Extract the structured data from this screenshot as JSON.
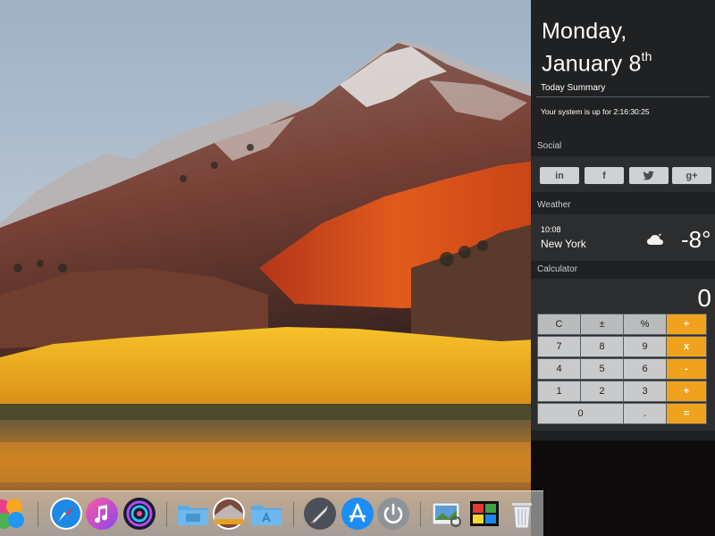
{
  "notification_center": {
    "date_line1": "Monday,",
    "date_day": "January 8",
    "date_suffix": "th",
    "today_summary_title": "Today Summary",
    "uptime_text": "Your system is up for 2:16:30:25",
    "social": {
      "label": "Social",
      "buttons": [
        {
          "name": "linkedin",
          "glyph": "in"
        },
        {
          "name": "facebook",
          "glyph": "f"
        },
        {
          "name": "twitter",
          "glyph": "🐦"
        },
        {
          "name": "googleplus",
          "glyph": "g+"
        }
      ]
    },
    "weather": {
      "label": "Weather",
      "time": "10:08",
      "city": "New York",
      "temperature": "-8°",
      "icon": "cloudy-night-icon"
    },
    "calculator": {
      "label": "Calculator",
      "display": "0",
      "keys": {
        "clear": "C",
        "plus_minus": "±",
        "percent": "%",
        "divide": "÷",
        "seven": "7",
        "eight": "8",
        "nine": "9",
        "multiply": "x",
        "four": "4",
        "five": "5",
        "six": "6",
        "minus": "-",
        "one": "1",
        "two": "2",
        "three": "3",
        "plus": "+",
        "zero": "0",
        "decimal": ".",
        "equals": "="
      }
    }
  },
  "dock": {
    "items": [
      {
        "name": "game-center-icon"
      },
      {
        "name": "safari-icon"
      },
      {
        "name": "itunes-icon"
      },
      {
        "name": "siri-icon"
      },
      {
        "name": "desktop-folder-icon"
      },
      {
        "name": "wallpaper-icon"
      },
      {
        "name": "applications-folder-icon"
      },
      {
        "name": "launchpad-icon"
      },
      {
        "name": "app-store-icon"
      },
      {
        "name": "power-icon"
      },
      {
        "name": "preview-icon"
      },
      {
        "name": "photo-booth-icon"
      },
      {
        "name": "trash-icon"
      }
    ]
  },
  "colors": {
    "panel_bg": "#1f2123",
    "calc_operator": "#f0a21e"
  }
}
